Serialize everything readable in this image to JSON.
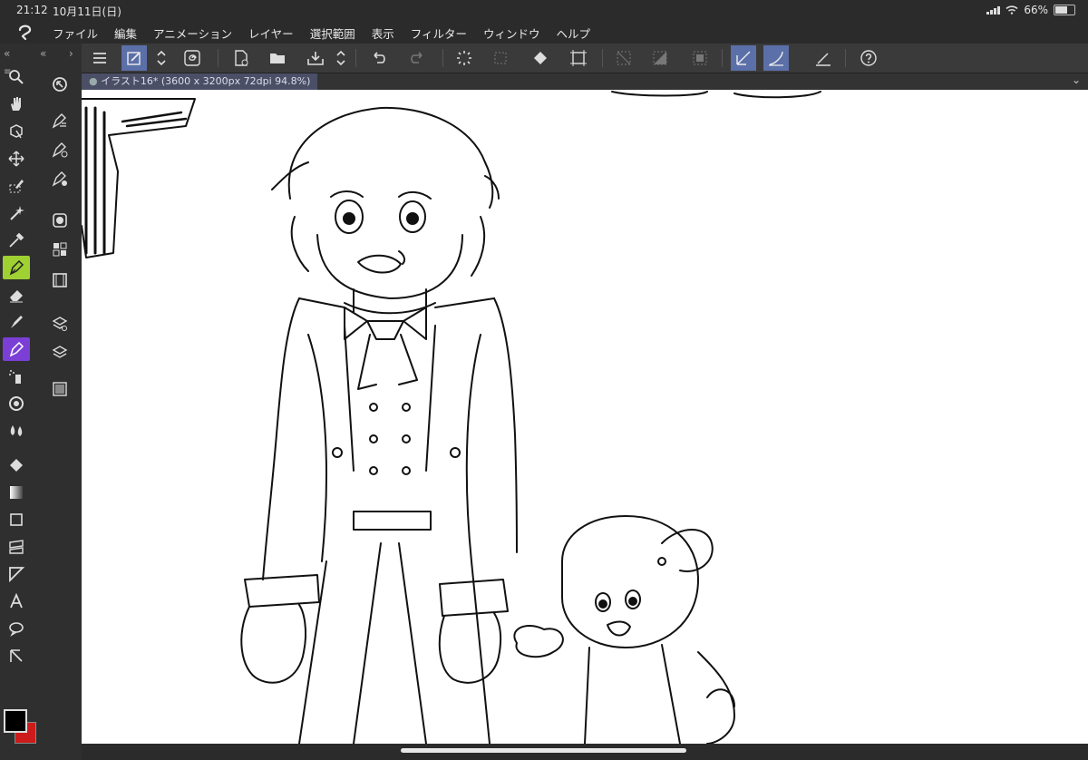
{
  "status": {
    "time": "21:12",
    "date": "10月11日(日)",
    "battery": "66%"
  },
  "menu": [
    "ファイル",
    "編集",
    "アニメーション",
    "レイヤー",
    "選択範囲",
    "表示",
    "フィルター",
    "ウィンドウ",
    "ヘルプ"
  ],
  "document": {
    "tab_label": "イラスト16* (3600 x 3200px 72dpi 94.8%)"
  },
  "colors": {
    "main": "#000000",
    "sub": "#cc1b1b",
    "accent": "#5b6fa8",
    "active_tool": "#9fd133"
  }
}
